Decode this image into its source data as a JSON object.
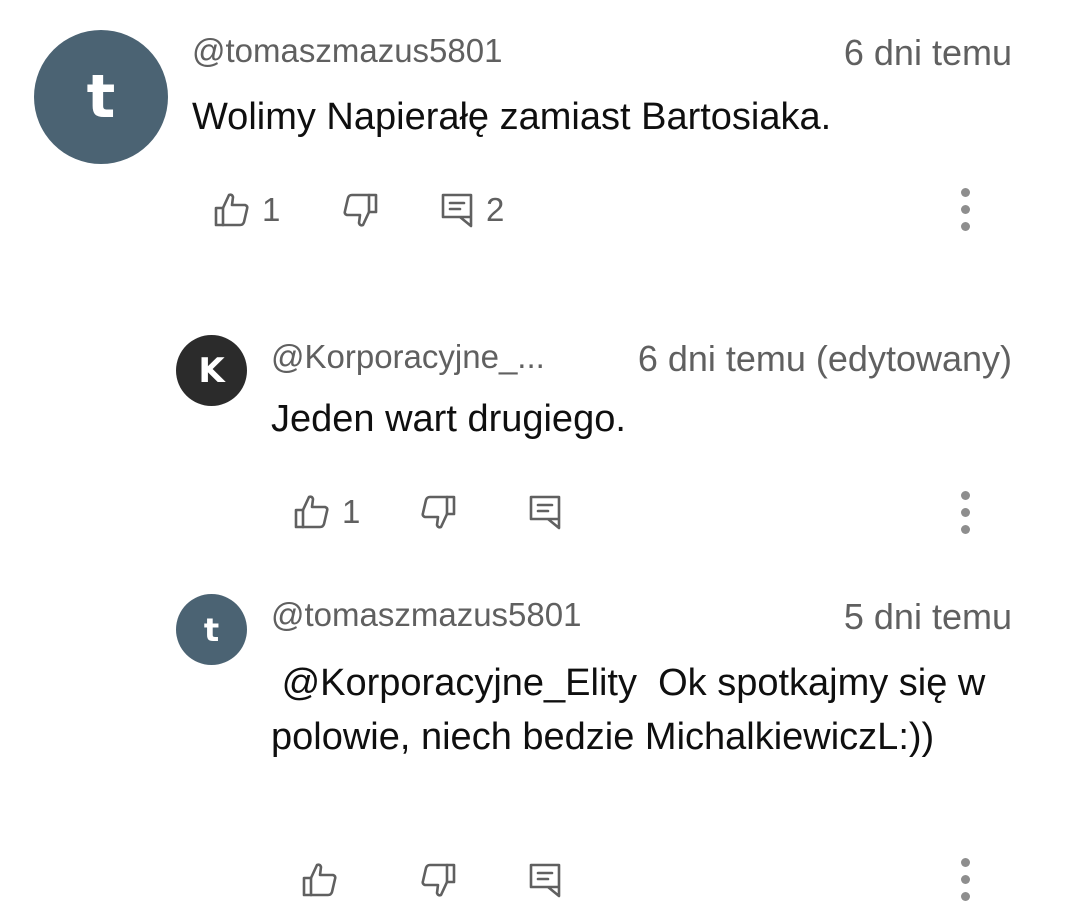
{
  "comments": [
    {
      "avatar_letter": "t",
      "username": "@tomaszmazus5801",
      "time": "6 dni temu",
      "text": "Wolimy Napierałę zamiast Bartosiaka.",
      "likes": "1",
      "replies": "2"
    },
    {
      "avatar_letter": "K",
      "username": "@Korporacyjne_...",
      "time": "6 dni temu (edytowany)",
      "text": "Jeden wart drugiego.",
      "likes": "1"
    },
    {
      "avatar_letter": "t",
      "username": "@tomaszmazus5801",
      "time": "5 dni temu",
      "text": " @Korporacyjne_Elity  Ok spotkajmy się w polowie, niech bedzie MichalkiewiczL:))"
    }
  ],
  "icons": {
    "like": "thumb-up-icon",
    "dislike": "thumb-down-icon",
    "reply": "reply-comment-icon",
    "more": "more-vertical-icon"
  },
  "colors": {
    "avatar_t": "#4b6373",
    "avatar_k": "#2b2b2b",
    "meta_text": "#606060",
    "body_text": "#0f0f0f"
  }
}
